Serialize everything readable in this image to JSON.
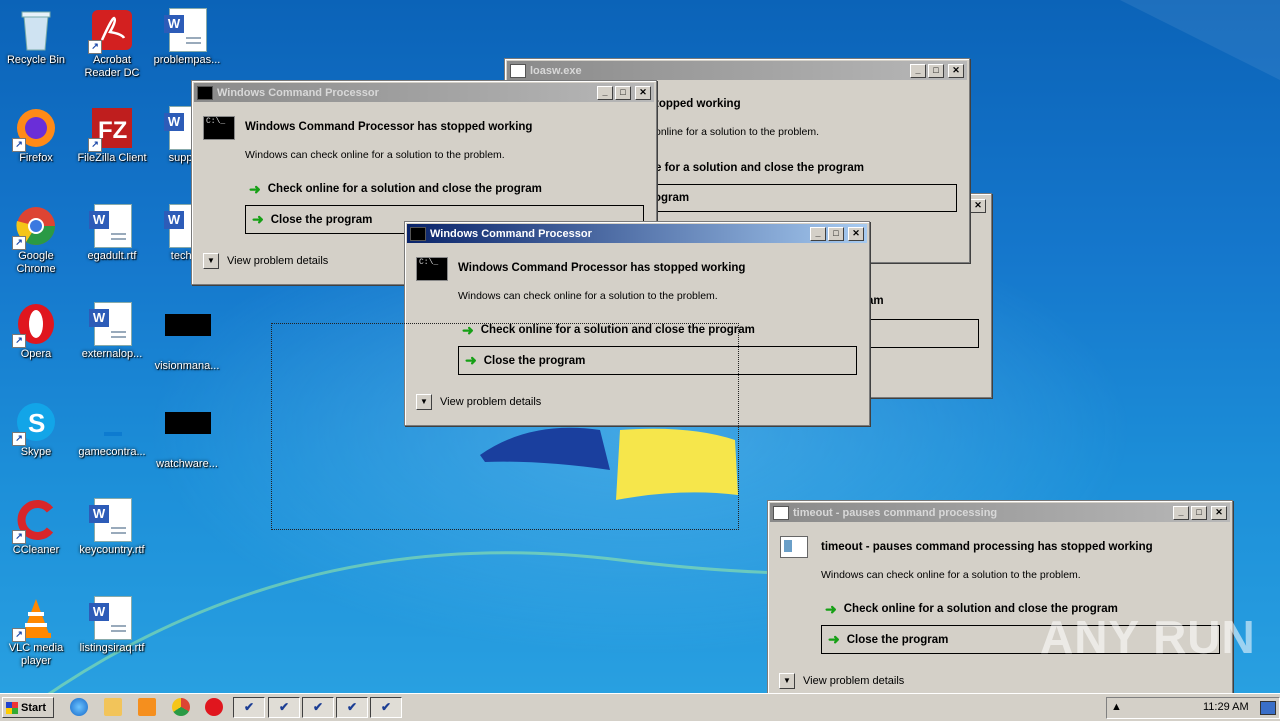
{
  "desktop": {
    "icons": [
      {
        "label": "Recycle Bin",
        "icon": "recycle-bin-icon"
      },
      {
        "label": "Acrobat Reader DC",
        "icon": "acrobat-icon"
      },
      {
        "label": "problempas...",
        "icon": "word-doc-icon"
      },
      {
        "label": "Firefox",
        "icon": "firefox-icon"
      },
      {
        "label": "FileZilla Client",
        "icon": "filezilla-icon"
      },
      {
        "label": "support",
        "icon": "word-doc-icon"
      },
      {
        "label": "Google Chrome",
        "icon": "chrome-icon"
      },
      {
        "label": "egadult.rtf",
        "icon": "word-doc-icon"
      },
      {
        "label": "techch",
        "icon": "word-doc-icon"
      },
      {
        "label": "Opera",
        "icon": "opera-icon"
      },
      {
        "label": "externalop...",
        "icon": "word-doc-icon"
      },
      {
        "label": "visionmana...",
        "icon": "black-file-icon"
      },
      {
        "label": "Skype",
        "icon": "skype-icon"
      },
      {
        "label": "gamecontra...",
        "icon": "blue-file-icon"
      },
      {
        "label": "watchware...",
        "icon": "black-file-icon"
      },
      {
        "label": "CCleaner",
        "icon": "ccleaner-icon"
      },
      {
        "label": "keycountry.rtf",
        "icon": "word-doc-icon"
      },
      {
        "label": "VLC media player",
        "icon": "vlc-icon"
      },
      {
        "label": "listingsiraq.rtf",
        "icon": "word-doc-icon"
      }
    ]
  },
  "windows": {
    "loasw": {
      "title": "loasw.exe",
      "heading_fragment": "topped working",
      "sub_fragment": "online for a solution to the problem.",
      "opt1_fragment": "e for a solution and close the program",
      "opt2_fragment": "ogram"
    },
    "behind": {
      "frag1": "am"
    },
    "cmd_back": {
      "title": "Windows Command Processor",
      "heading": "Windows Command Processor has stopped working",
      "sub": "Windows can check online for a solution to the problem.",
      "opt1": "Check online for a solution and close the program",
      "opt2": "Close the program",
      "details": "View problem details"
    },
    "cmd_front": {
      "title": "Windows Command Processor",
      "heading": "Windows Command Processor has stopped working",
      "sub": "Windows can check online for a solution to the problem.",
      "opt1": "Check online for a solution and close the program",
      "opt2": "Close the program",
      "details": "View problem details"
    },
    "timeout": {
      "title": "timeout - pauses command processing",
      "heading": "timeout - pauses command processing has stopped working",
      "sub": "Windows can check online for a solution to the problem.",
      "opt1": "Check online for a solution and close the program",
      "opt2": "Close the program",
      "details": "View problem details"
    }
  },
  "titlebar_buttons": {
    "minimize": "_",
    "maximize": "□",
    "close": "✕"
  },
  "taskbar": {
    "start_label": "Start",
    "clock": "11:29 AM",
    "quick_launch": [
      "ie-icon",
      "explorer-icon",
      "media-player-icon",
      "chrome-icon",
      "opera-icon"
    ],
    "task_buttons": 5
  },
  "watermark": "ANY RUN",
  "colors": {
    "active_title": "#0a246a",
    "inactive_title": "#8a8a8a",
    "dialog_bg": "#d4d0c8",
    "arrow": "#16a016"
  }
}
